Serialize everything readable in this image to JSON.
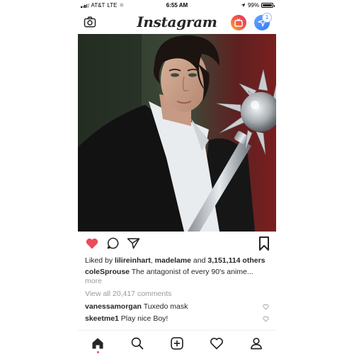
{
  "status_bar": {
    "carrier": "AT&T",
    "network": "LTE",
    "time": "6:55 AM",
    "battery": "99%",
    "battery_level": 0.99,
    "icons": [
      "signal-bars-icon",
      "loading-icon",
      "location-arrow-icon",
      "battery-icon"
    ]
  },
  "header": {
    "logo": "Instagram",
    "dm_badge": "1",
    "icons": [
      "camera-icon",
      "igtv-icon",
      "direct-message-icon"
    ]
  },
  "post": {
    "likes_prefix": "Liked by ",
    "liker1": "lilireinhart",
    "liker_sep": ", ",
    "liker2": "madelame",
    "likes_and": " and ",
    "likes_count": "3,151,114 others",
    "author": "coleSprouse",
    "caption": "The antagonist of every 90's anime...",
    "more": "more",
    "view_comments": "View all 20,417 comments",
    "comments": [
      {
        "user": "vanessamorgan",
        "text": "Tuxedo mask"
      },
      {
        "user": "skeetme1",
        "text": "Play nice Boy!"
      }
    ],
    "liked": true,
    "accent_color": "#ed4956"
  },
  "bottom_nav": {
    "icons": [
      "home-icon",
      "search-icon",
      "add-post-icon",
      "activity-heart-icon",
      "profile-icon"
    ]
  }
}
